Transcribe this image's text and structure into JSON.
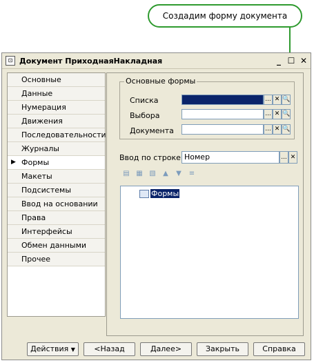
{
  "callout": {
    "text": "Создадим форму документа"
  },
  "window": {
    "title": "Документ ПриходнаяНакладная"
  },
  "sidebar": {
    "items": [
      {
        "label": "Основные"
      },
      {
        "label": "Данные"
      },
      {
        "label": "Нумерация"
      },
      {
        "label": "Движения"
      },
      {
        "label": "Последовательности"
      },
      {
        "label": "Журналы"
      },
      {
        "label": "Формы",
        "active": true
      },
      {
        "label": "Макеты"
      },
      {
        "label": "Подсистемы"
      },
      {
        "label": "Ввод на основании"
      },
      {
        "label": "Права"
      },
      {
        "label": "Интерфейсы"
      },
      {
        "label": "Обмен данными"
      },
      {
        "label": "Прочее"
      }
    ]
  },
  "main_forms": {
    "legend": "Основные формы",
    "fields": [
      {
        "label": "Списка",
        "value": ""
      },
      {
        "label": "Выбора",
        "value": ""
      },
      {
        "label": "Документа",
        "value": ""
      }
    ]
  },
  "input_by_string": {
    "label": "Ввод по строке",
    "value": "Номер"
  },
  "tree": {
    "root": "Формы"
  },
  "buttons": {
    "actions": "Действия",
    "back": "<Назад",
    "next": "Далее>",
    "close": "Закрыть",
    "help": "Справка"
  },
  "icons": {
    "ellipsis": "...",
    "clear": "✕",
    "open": "🔍"
  },
  "colors": {
    "callout_border": "#2e9a2e",
    "selection": "#0a246a"
  }
}
